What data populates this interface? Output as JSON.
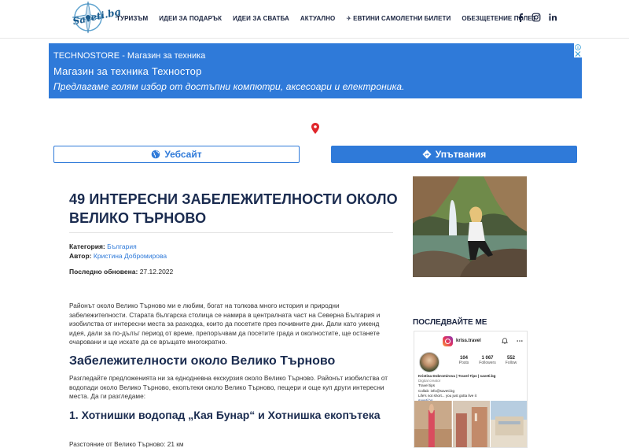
{
  "header": {
    "logo_text": "Saveti.bg",
    "nav": [
      {
        "label": "ТУРИЗЪМ"
      },
      {
        "label": "ИДЕИ ЗА ПОДАРЪК"
      },
      {
        "label": "ИДЕИ ЗА СВАТБА"
      },
      {
        "label": "АКТУАЛНО"
      },
      {
        "label": "ЕВТИНИ САМОЛЕТНИ БИЛЕТИ",
        "icon": "plane-icon"
      },
      {
        "label": "ОБЕЗЩЕТЕНИЕ ПОЛЕТ"
      }
    ],
    "social": [
      "facebook-icon",
      "instagram-icon",
      "linkedin-icon"
    ]
  },
  "ad": {
    "store": "TECHNOSTORE - Магазин за техника",
    "headline": "Магазин за техника Техностор",
    "description": "Предлагаме голям избор от достъпни компютри, аксесоари и електроника.",
    "bg_color": "#2f7ad9"
  },
  "buttons": {
    "website": "Уебсайт",
    "directions": "Упътвания"
  },
  "article": {
    "title": "49 ИНТЕРЕСНИ ЗАБЕЛЕЖИТЕЛНОСТИ ОКОЛО ВЕЛИКО ТЪРНОВО",
    "category_label": "Категория:",
    "category": "България",
    "author_label": "Автор:",
    "author": "Кристина Добромирова",
    "updated_label": "Последно обновена:",
    "updated": "27.12.2022",
    "intro": "Районът около Велико Търново ми е любим, богат на толкова много история и природни забележителности. Старата българска столица се намира в централната част на Северна България и изобилства от интересни места за разходка, които да посетите през почивните дни. Дали като уикенд идея, дали за по-дълъг период от време, препоръчвам да посетите града и околностите, ще останете очаровани и ще искате да се връщате многократно.",
    "section_heading": "Забележителности около Велико Търново",
    "section_text": "Разгледайте предложенията ни за еднодневна екскурзия около Велико Търново. Районът изобилства от водопади около Велико Търново, екопътеки около Велико Търново, пещери и още куп други интересни места. Да ги разгледаме:",
    "item_heading": "1. Хотнишки водопад „Кая Бунар“ и Хотнишка екопътека",
    "item_distance": "Разстояние от Велико Търново: 21 км"
  },
  "sidebar": {
    "follow_heading": "ПОСЛЕДВАЙТЕ МЕ",
    "instagram": {
      "handle": "kriss.travel",
      "posts": "104",
      "posts_label": "Posts",
      "followers": "1 067",
      "followers_label": "Followers",
      "following": "552",
      "following_label": "Follow",
      "bio": [
        "Kristina Dobromirova | Travel Tips | saveti.bg",
        "Digital creator",
        "Travel tips",
        "Collab: info@saveti.bg",
        "Life's not short... you just gotta live it",
        "saveti.bg"
      ]
    }
  }
}
